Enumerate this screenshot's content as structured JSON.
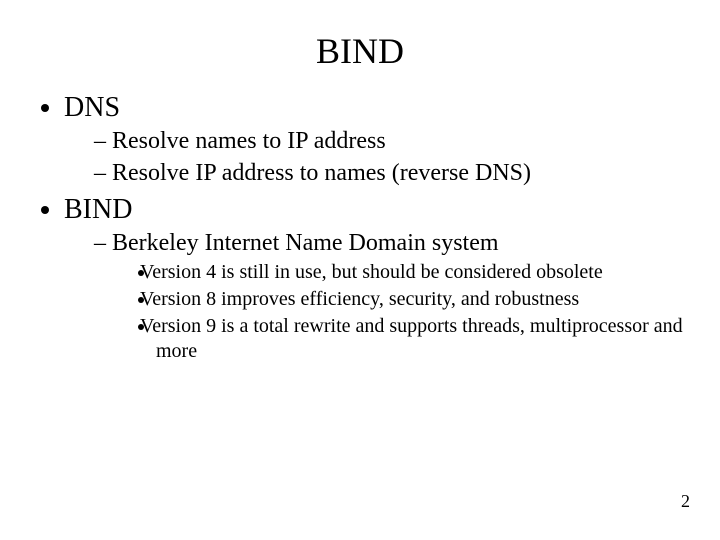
{
  "title": "BIND",
  "sections": [
    {
      "heading": "DNS",
      "sub": [
        "Resolve names to IP address",
        "Resolve IP address to names (reverse DNS)"
      ]
    },
    {
      "heading": "BIND",
      "sub": [
        "Berkeley Internet Name Domain system"
      ],
      "subsub": [
        "Version 4 is still in use, but should be considered obsolete",
        "Version 8 improves efficiency, security, and robustness",
        "Version 9 is a total rewrite and supports threads, multiprocessor and more"
      ]
    }
  ],
  "page_number": "2"
}
